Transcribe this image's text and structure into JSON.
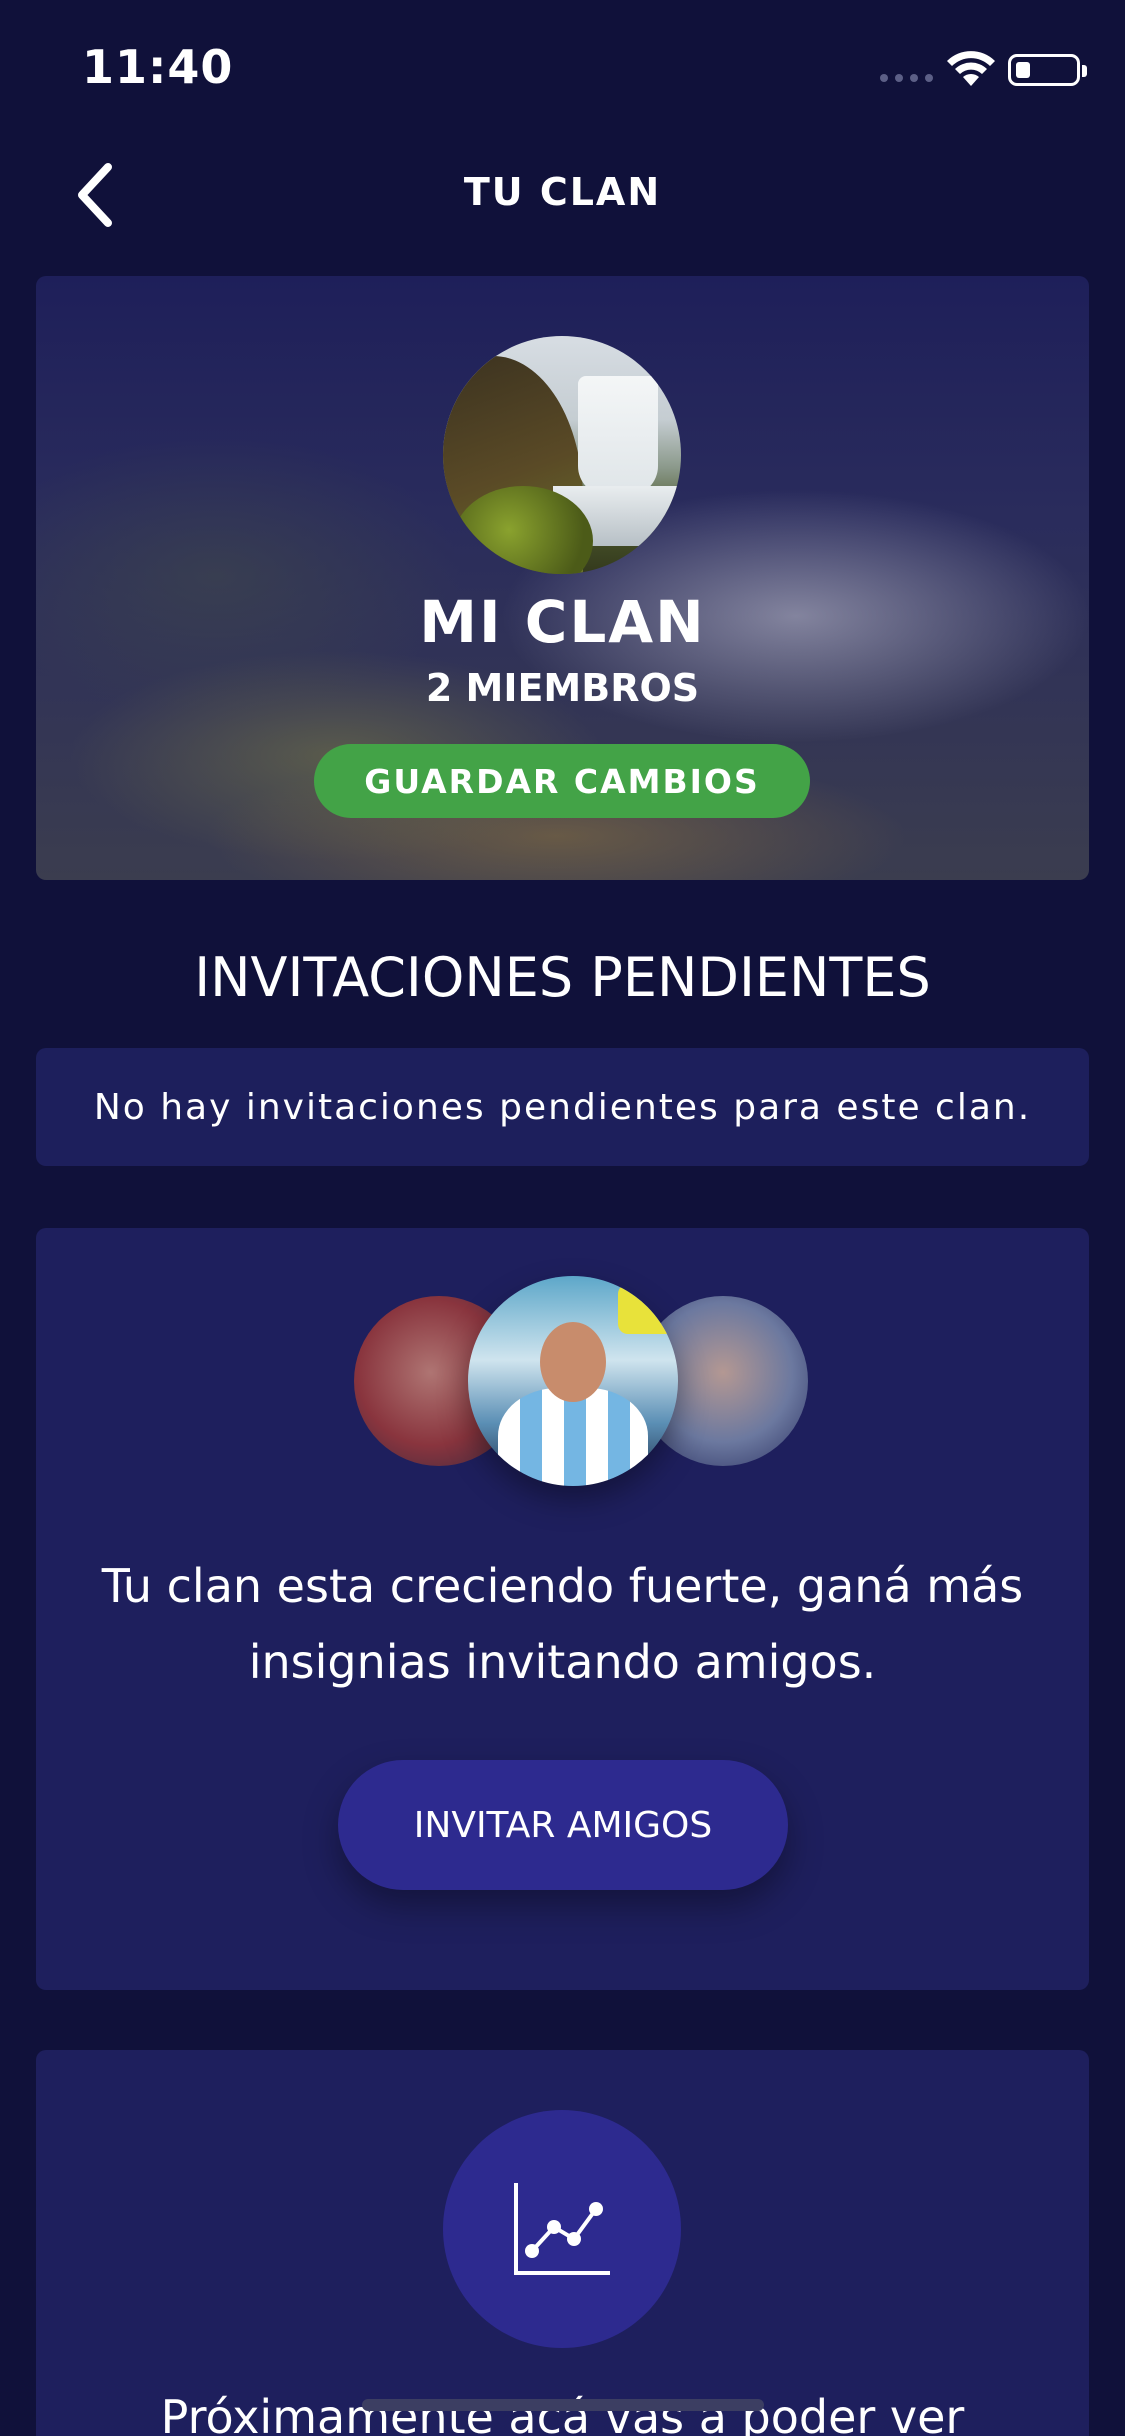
{
  "status_bar": {
    "time": "11:40"
  },
  "header": {
    "title": "TU CLAN"
  },
  "clan": {
    "name": "MI CLAN",
    "members": "2 MIEMBROS",
    "save_label": "GUARDAR CAMBIOS"
  },
  "pending": {
    "title": "INVITACIONES PENDIENTES",
    "empty_message": "No hay invitaciones pendientes para este clan."
  },
  "invite": {
    "text": "Tu clan esta creciendo fuerte, ganá más insignias invitando amigos.",
    "button_label": "INVITAR AMIGOS"
  },
  "stats": {
    "text": "Próximamente acá vas a poder ver"
  },
  "icons": {
    "back": "chevron-left-icon",
    "wifi": "wifi-icon",
    "battery": "battery-icon",
    "chart": "line-chart-icon"
  },
  "colors": {
    "background": "#10113a",
    "card": "#1e1f5d",
    "accent_green": "#43a347",
    "accent_purple": "#2d2a8f"
  }
}
